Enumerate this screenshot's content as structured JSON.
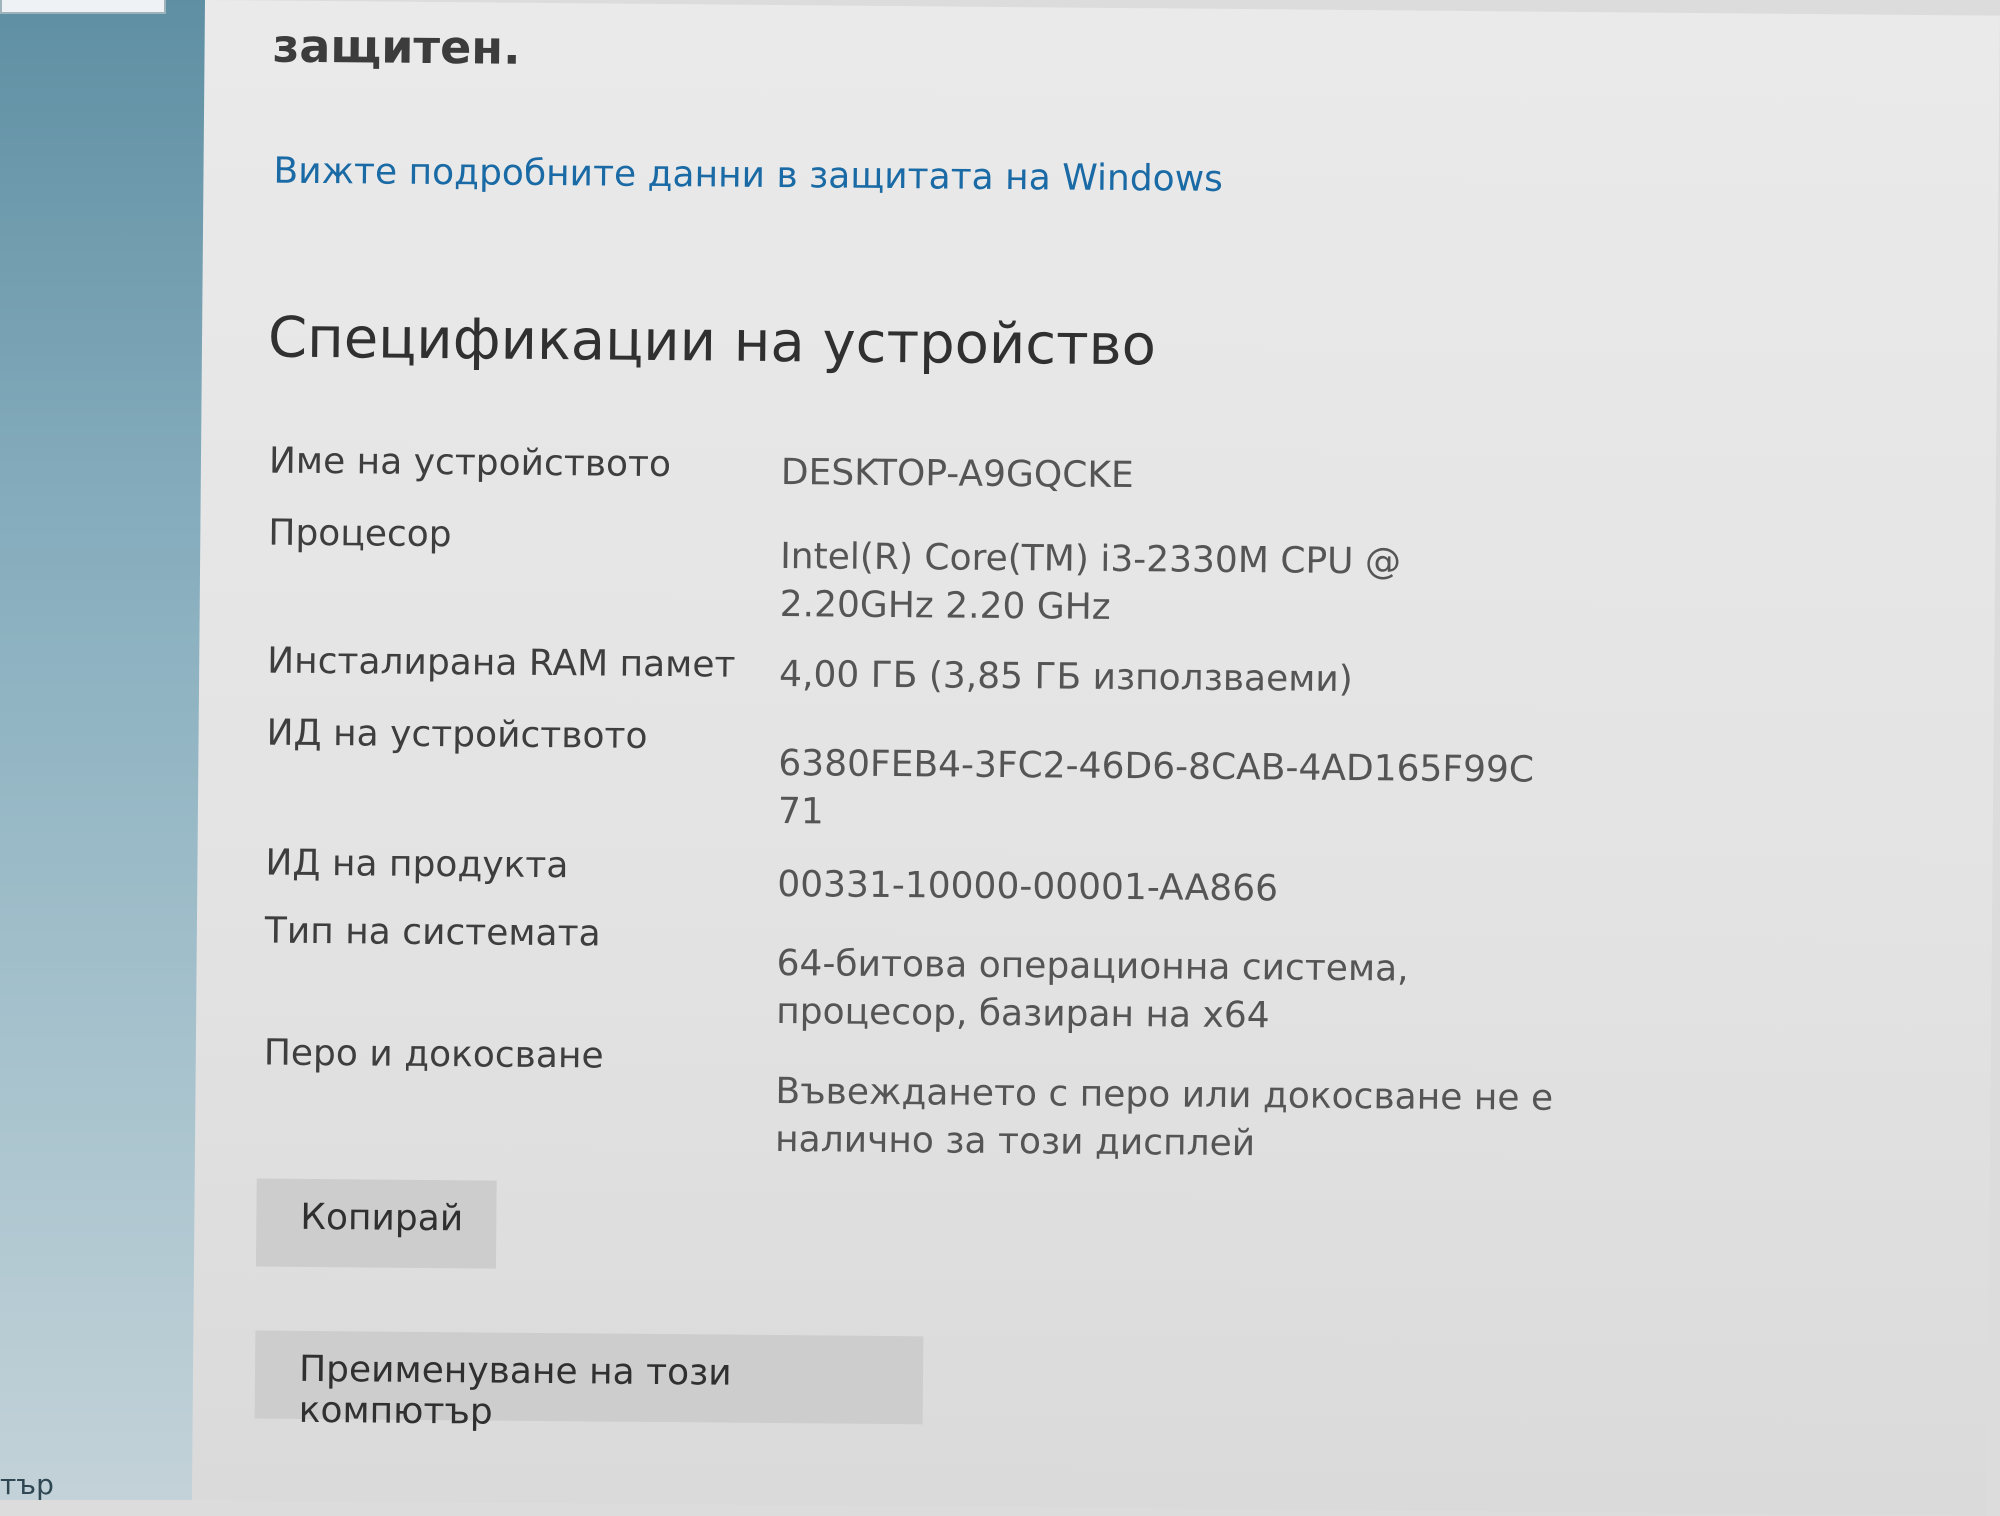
{
  "sidebar": {
    "bottom_text": "тър"
  },
  "main": {
    "protected_text": "защитен.",
    "defender_link": "Вижте подробните данни в защитата на Windows",
    "section_title": "Спецификации на устройство",
    "specs": [
      {
        "label": "Име на устройството",
        "value": "DESKTOP-A9GQCKE"
      },
      {
        "label": "Процесор",
        "value": "Intel(R) Core(TM) i3-2330M CPU @\n2.20GHz   2.20 GHz"
      },
      {
        "label": "Инсталирана RAM памет",
        "value": "4,00 ГБ (3,85 ГБ използваеми)"
      },
      {
        "label": "ИД на устройството",
        "value": "6380FEB4-3FC2-46D6-8CAB-4AD165F99C\n71"
      },
      {
        "label": "ИД на продукта",
        "value": "00331-10000-00001-AA866"
      },
      {
        "label": "Тип на системата",
        "value": "64-битова операционна система,\nпроцесор, базиран на x64"
      },
      {
        "label": "Перо и докосване",
        "value": "Въвеждането с перо или докосване не е\nналично за този дисплей"
      }
    ],
    "copy_button": "Копирай",
    "rename_button": "Преименуване на този компютър"
  }
}
